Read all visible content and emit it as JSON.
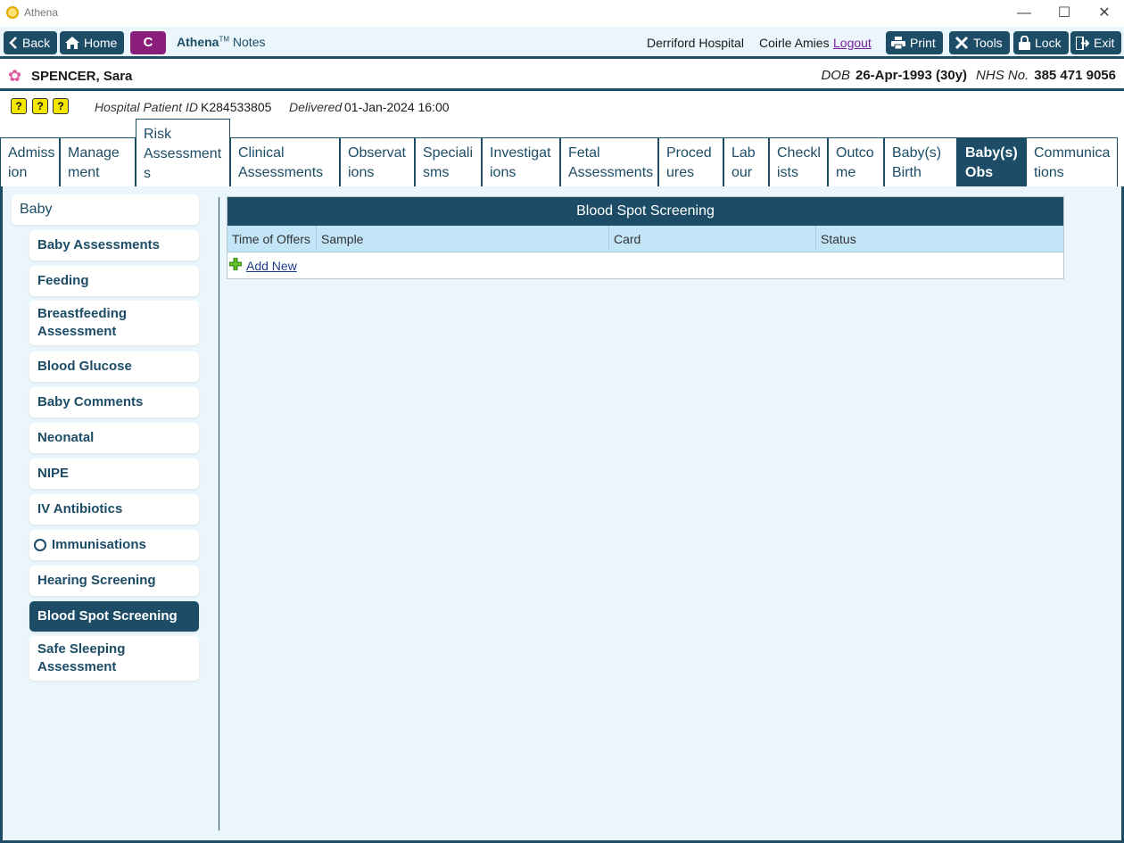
{
  "window": {
    "title": "Athena",
    "controls": {
      "minimize": "—",
      "maximize": "☐",
      "close": "✕"
    }
  },
  "toolbar": {
    "back": "Back",
    "home": "Home",
    "c_button": "C",
    "brand_name": "Athena",
    "brand_tm": "TM",
    "brand_suffix": " Notes",
    "hospital": "Derriford Hospital",
    "user": "Coirle Amies",
    "logout": "Logout",
    "print": "Print",
    "tools": "Tools",
    "lock": "Lock",
    "exit": "Exit"
  },
  "patient": {
    "icon": "flower-icon",
    "name": "SPENCER, Sara",
    "dob_label": "DOB",
    "dob_value": "26-Apr-1993 (30y)",
    "nhs_label": "NHS No.",
    "nhs_value": "385 471 9056"
  },
  "info": {
    "alerts": [
      "?",
      "?",
      "?"
    ],
    "hospital_id_label": "Hospital Patient ID",
    "hospital_id_value": "K284533805",
    "delivered_label": "Delivered",
    "delivered_value": "01-Jan-2024 16:00"
  },
  "tabs": [
    {
      "line1": "Admiss",
      "line2": "ion"
    },
    {
      "line1": "Manage",
      "line2": "ment"
    },
    {
      "line1": "Risk",
      "line2": "Assessment",
      "line3": "s"
    },
    {
      "line1": "Clinical",
      "line2": "Assessments"
    },
    {
      "line1": "Observat",
      "line2": "ions"
    },
    {
      "line1": "Speciali",
      "line2": "sms"
    },
    {
      "line1": "Investigat",
      "line2": "ions"
    },
    {
      "line1": "Fetal",
      "line2": "Assessments"
    },
    {
      "line1": "Proced",
      "line2": "ures"
    },
    {
      "line1": "Lab",
      "line2": "our"
    },
    {
      "line1": "Checkl",
      "line2": "ists"
    },
    {
      "line1": "Outco",
      "line2": "me"
    },
    {
      "line1": "Baby(s)",
      "line2": "Birth"
    },
    {
      "line1": "Baby(s)",
      "line2": "Obs"
    },
    {
      "line1": "Communica",
      "line2": "tions"
    }
  ],
  "active_tab": "Baby(s) Obs",
  "sidebar": {
    "root": "Baby",
    "items": [
      {
        "label": "Baby Assessments"
      },
      {
        "label": "Feeding"
      },
      {
        "label": "Breastfeeding Assessment"
      },
      {
        "label": "Blood Glucose"
      },
      {
        "label": "Baby Comments"
      },
      {
        "label": "Neonatal"
      },
      {
        "label": "NIPE"
      },
      {
        "label": "IV Antibiotics"
      },
      {
        "label": "Immunisations"
      },
      {
        "label": "Hearing Screening"
      },
      {
        "label": "Blood Spot Screening"
      },
      {
        "label": "Safe Sleeping Assessment"
      }
    ],
    "active_item": "Blood Spot Screening"
  },
  "main": {
    "title": "Blood Spot Screening",
    "columns": [
      "Time of Offers",
      "Sample",
      "Card",
      "Status"
    ],
    "rows": [],
    "add_new": "Add New"
  },
  "colors": {
    "primary": "#1c4c66",
    "background": "#eaf6fb",
    "header_row": "#c2e6f7",
    "c_button": "#8b1e7b",
    "alert": "#f3e600"
  }
}
